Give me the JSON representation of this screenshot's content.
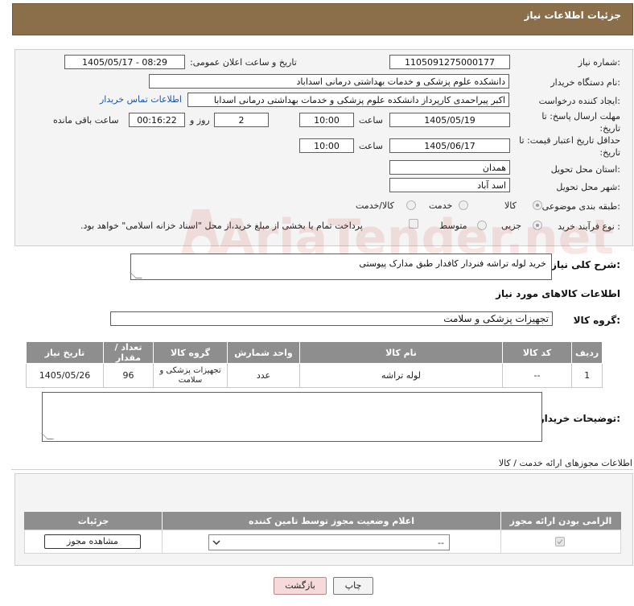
{
  "header": {
    "title": "جزئیات اطلاعات نیاز"
  },
  "form": {
    "need_number_label": "شماره نیاز:",
    "need_number": "1105091275000177",
    "announce_label": "تاریخ و ساعت اعلان عمومی:",
    "announce_value": "1405/05/17 - 08:29",
    "buyer_org_label": "نام دستگاه خریدار:",
    "buyer_org": "دانشکده علوم پزشکی و خدمات بهداشتی درمانی اسداباد",
    "requester_label": "ایجاد کننده درخواست:",
    "requester": "اکبر پیراحمدی کارپرداز دانشکده علوم پزشکی و خدمات بهداشتی درمانی اسدابا",
    "contact_link": "اطلاعات تماس خریدار",
    "reply_deadline_label": "مهلت ارسال پاسخ: تا تاریخ:",
    "reply_date": "1405/05/19",
    "time_label": "ساعت",
    "reply_time": "10:00",
    "days_value": "2",
    "days_label": "روز و",
    "remaining_time": "00:16:22",
    "remaining_label": "ساعت باقی مانده",
    "price_validity_label": "حداقل تاریخ اعتبار قیمت: تا تاریخ:",
    "price_date": "1405/06/17",
    "price_time": "10:00",
    "province_label": "استان محل تحویل:",
    "province": "همدان",
    "city_label": "شهر محل تحویل:",
    "city": "اسد آباد",
    "category_label": "طبقه بندی موضوعی:",
    "category_options": [
      "کالا",
      "خدمت",
      "کالا/خدمت"
    ],
    "process_label": "نوع فرآیند خرید :",
    "process_options": [
      "جزیی",
      "متوسط"
    ],
    "payment_note": "پرداخت تمام یا بخشی از مبلغ خرید،از محل \"اسناد خزانه اسلامی\" خواهد بود."
  },
  "description": {
    "label": "شرح کلی نیاز:",
    "value": "خرید لوله تراشه فنردار کافدار طبق مدارک پیوستی"
  },
  "goods": {
    "section_title": "اطلاعات کالاهای مورد نیاز",
    "group_label": "گروه کالا:",
    "group_value": "تجهیزات پزشکی و سلامت",
    "columns": [
      "ردیف",
      "کد کالا",
      "نام کالا",
      "واحد شمارش",
      "گروه کالا",
      "تعداد / مقدار",
      "تاریخ نیاز"
    ],
    "rows": [
      [
        "1",
        "--",
        "لوله تراشه",
        "عدد",
        "تجهیزات پزشکی و سلامت",
        "96",
        "1405/05/26"
      ]
    ],
    "buyer_notes_label": "توضیحات خریدار:"
  },
  "permits": {
    "section_title": "اطلاعات مجوزهای ارائه خدمت / کالا",
    "columns": [
      "الزامی بودن ارائه مجوز",
      "اعلام وضعیت مجوز توسط تامین کننده",
      "جزئیات"
    ],
    "select_value": "--",
    "view_button": "مشاهده مجوز"
  },
  "footer": {
    "print_button": "چاپ",
    "back_button": "بازگشت"
  },
  "watermark": {
    "text": "AriaTender.net"
  }
}
